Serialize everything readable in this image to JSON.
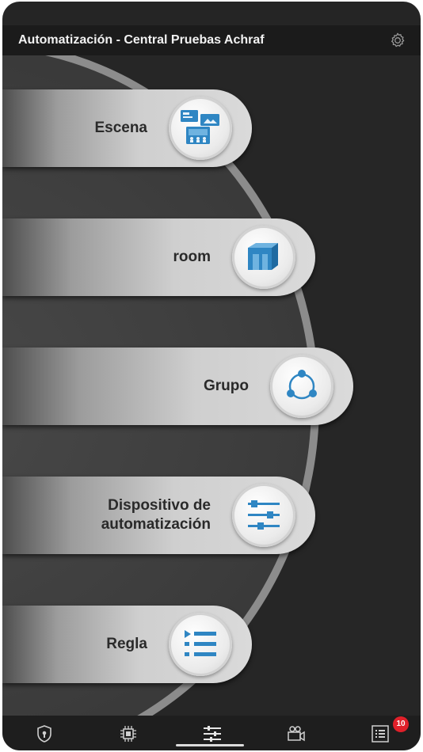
{
  "header": {
    "title": "Automatización - Central Pruebas Achraf",
    "settings_icon": "gear-icon"
  },
  "menu": [
    {
      "label": "Escena",
      "icon": "scene-icon"
    },
    {
      "label": "room",
      "icon": "room-icon"
    },
    {
      "label": "Grupo",
      "icon": "group-icon"
    },
    {
      "label": "Dispositivo de automatización",
      "icon": "sliders-icon"
    },
    {
      "label": "Regla",
      "icon": "rule-list-icon"
    }
  ],
  "tabbar": {
    "tabs": [
      {
        "icon": "shield-lock-icon"
      },
      {
        "icon": "chip-icon"
      },
      {
        "icon": "sliders-tab-icon",
        "active": true
      },
      {
        "icon": "camera-icon"
      },
      {
        "icon": "list-icon"
      }
    ],
    "badge": "10"
  },
  "colors": {
    "accent_blue": "#2f86c3",
    "background": "#262626",
    "badge": "#e0202a"
  }
}
